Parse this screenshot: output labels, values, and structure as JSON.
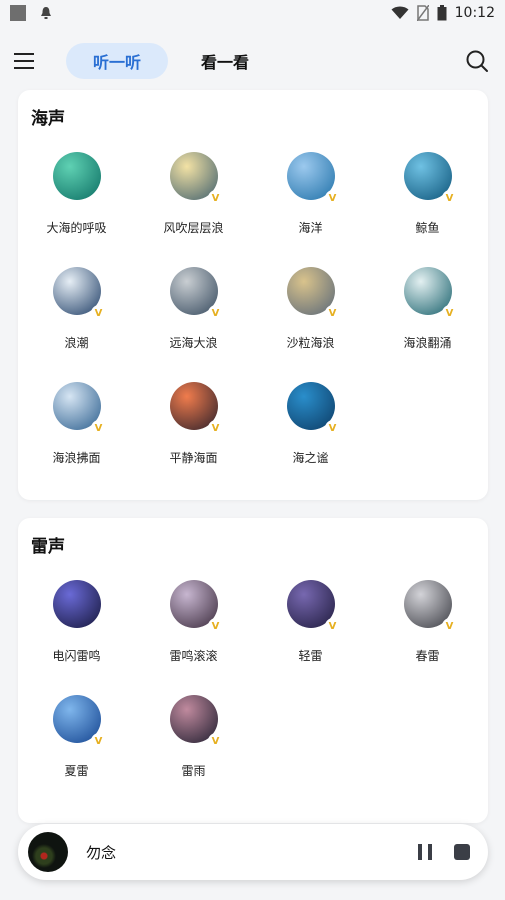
{
  "status_bar": {
    "time": "10:12"
  },
  "header": {
    "tabs": [
      {
        "label": "听一听",
        "active": true
      },
      {
        "label": "看一看",
        "active": false
      }
    ]
  },
  "sections": [
    {
      "title": "海声",
      "items": [
        {
          "label": "大海的呼吸",
          "colors": [
            "#5fd1b3",
            "#0c6e63"
          ],
          "vip": false
        },
        {
          "label": "风吹层层浪",
          "colors": [
            "#f3e2a5",
            "#3e5e6c"
          ],
          "vip": true
        },
        {
          "label": "海洋",
          "colors": [
            "#9cc9ee",
            "#2071a8"
          ],
          "vip": true
        },
        {
          "label": "鲸鱼",
          "colors": [
            "#6fc1e3",
            "#0d5479"
          ],
          "vip": true
        },
        {
          "label": "浪潮",
          "colors": [
            "#e6eef5",
            "#1f3e66"
          ],
          "vip": true
        },
        {
          "label": "远海大浪",
          "colors": [
            "#c9ced2",
            "#35495d"
          ],
          "vip": true
        },
        {
          "label": "沙粒海浪",
          "colors": [
            "#d9c38c",
            "#596778"
          ],
          "vip": true
        },
        {
          "label": "海浪翻涌",
          "colors": [
            "#e3f0f1",
            "#17606b"
          ],
          "vip": true
        },
        {
          "label": "海浪拂面",
          "colors": [
            "#d6e5f3",
            "#2b5e8d"
          ],
          "vip": true
        },
        {
          "label": "平静海面",
          "colors": [
            "#f07c4d",
            "#2b1f2a"
          ],
          "vip": true
        },
        {
          "label": "海之谧",
          "colors": [
            "#2a8ecb",
            "#0c3b64"
          ],
          "vip": true
        }
      ]
    },
    {
      "title": "雷声",
      "items": [
        {
          "label": "电闪雷鸣",
          "colors": [
            "#6a6ad6",
            "#15163a"
          ],
          "vip": false
        },
        {
          "label": "雷鸣滚滚",
          "colors": [
            "#c7b6d0",
            "#3a2a3b"
          ],
          "vip": true
        },
        {
          "label": "轻雷",
          "colors": [
            "#7768b0",
            "#1f1b3d"
          ],
          "vip": true
        },
        {
          "label": "春雷",
          "colors": [
            "#d3d3d8",
            "#3a3b42"
          ],
          "vip": true
        },
        {
          "label": "夏雷",
          "colors": [
            "#7fb6ec",
            "#13438f"
          ],
          "vip": true
        },
        {
          "label": "雷雨",
          "colors": [
            "#c08a9e",
            "#1e1d2e"
          ],
          "vip": true
        }
      ]
    }
  ],
  "player": {
    "title": "勿念"
  },
  "vip_badge": "V"
}
